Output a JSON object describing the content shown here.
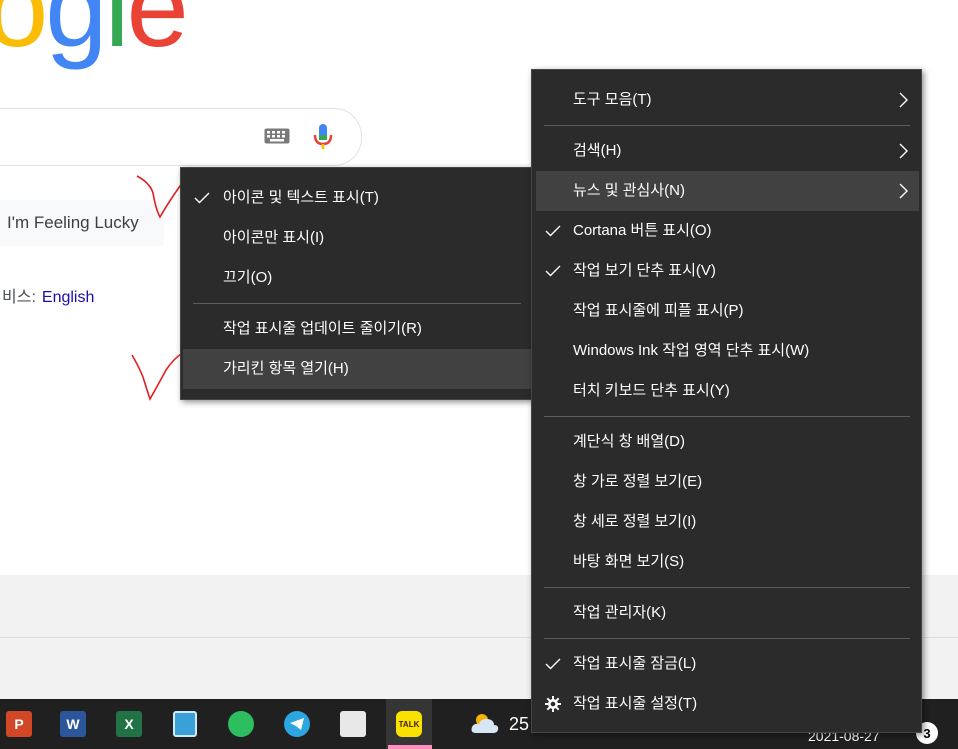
{
  "google": {
    "logo_letters": [
      {
        "ch": "o",
        "color": "#fbbc05"
      },
      {
        "ch": "g",
        "color": "#4285f4"
      },
      {
        "ch": "l",
        "color": "#34a853"
      },
      {
        "ch": "e",
        "color": "#ea4335"
      }
    ],
    "lucky_button": "I'm Feeling Lucky",
    "lang_prefix": "비스:",
    "lang_link": "English"
  },
  "submenu": {
    "items": [
      {
        "label": "아이콘 및 텍스트 표시(T)",
        "checked": true
      },
      {
        "label": "아이콘만 표시(I)",
        "checked": false
      },
      {
        "label": "끄기(O)",
        "checked": false
      },
      {
        "label": "작업 표시줄 업데이트 줄이기(R)",
        "checked": false
      },
      {
        "label": "가리킨 항목 열기(H)",
        "checked": false
      }
    ]
  },
  "context_menu": {
    "items": [
      {
        "label": "도구 모음(T)",
        "submenu": true
      },
      {
        "label": "검색(H)",
        "submenu": true
      },
      {
        "label": "뉴스 및 관심사(N)",
        "submenu": true
      },
      {
        "label": "Cortana 버튼 표시(O)",
        "checked": true
      },
      {
        "label": "작업 보기 단추 표시(V)",
        "checked": true
      },
      {
        "label": "작업 표시줄에 피플 표시(P)"
      },
      {
        "label": "Windows Ink 작업 영역 단추 표시(W)"
      },
      {
        "label": "터치 키보드 단추 표시(Y)"
      },
      {
        "label": "계단식 창 배열(D)"
      },
      {
        "label": "창 가로 정렬 보기(E)"
      },
      {
        "label": "창 세로 정렬 보기(I)"
      },
      {
        "label": "바탕 화면 보기(S)"
      },
      {
        "label": "작업 관리자(K)"
      },
      {
        "label": "작업 표시줄 잠금(L)",
        "checked": true
      },
      {
        "label": "작업 표시줄 설정(T)",
        "icon": "gear-icon"
      }
    ]
  },
  "taskbar": {
    "apps": [
      {
        "name": "powerpoint-icon",
        "letter": "P",
        "color": "#d24726"
      },
      {
        "name": "word-icon",
        "letter": "W",
        "color": "#2b579a"
      },
      {
        "name": "excel-icon",
        "letter": "X",
        "color": "#217346"
      },
      {
        "name": "notepad-icon",
        "letter": "",
        "color": "#3aa0d8"
      },
      {
        "name": "evernote-icon",
        "letter": "",
        "color": "#2dbe60"
      },
      {
        "name": "telegram-icon",
        "letter": "",
        "color": "#2ca5e0"
      },
      {
        "name": "pdf24-icon",
        "letter": "",
        "color": "#e8e8e8"
      },
      {
        "name": "kakaotalk-icon",
        "letter": "TALK",
        "color": "#fae100"
      }
    ],
    "weather_temp": "25",
    "date": "2021-08-27",
    "notification_count": "3"
  }
}
